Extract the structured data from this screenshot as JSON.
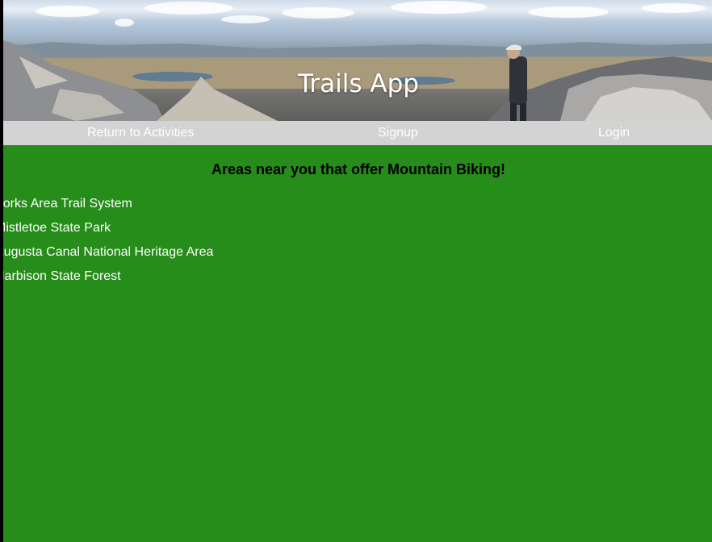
{
  "header": {
    "title": "Trails App",
    "banner_image": "mountain-summit-panorama"
  },
  "nav": {
    "items": [
      {
        "label": "Return to Activities"
      },
      {
        "label": "Signup"
      },
      {
        "label": "Login"
      }
    ]
  },
  "main": {
    "heading": "Areas near you that offer Mountain Biking!",
    "areas": [
      {
        "name": "Forks Area Trail System"
      },
      {
        "name": "Mistletoe State Park"
      },
      {
        "name": "Augusta Canal National Heritage Area"
      },
      {
        "name": "Harbison State Forest"
      }
    ]
  },
  "colors": {
    "background": "#268c1a",
    "nav_background": "#d3d3d3",
    "text_light": "#ffffff",
    "heading_text": "#000000"
  }
}
